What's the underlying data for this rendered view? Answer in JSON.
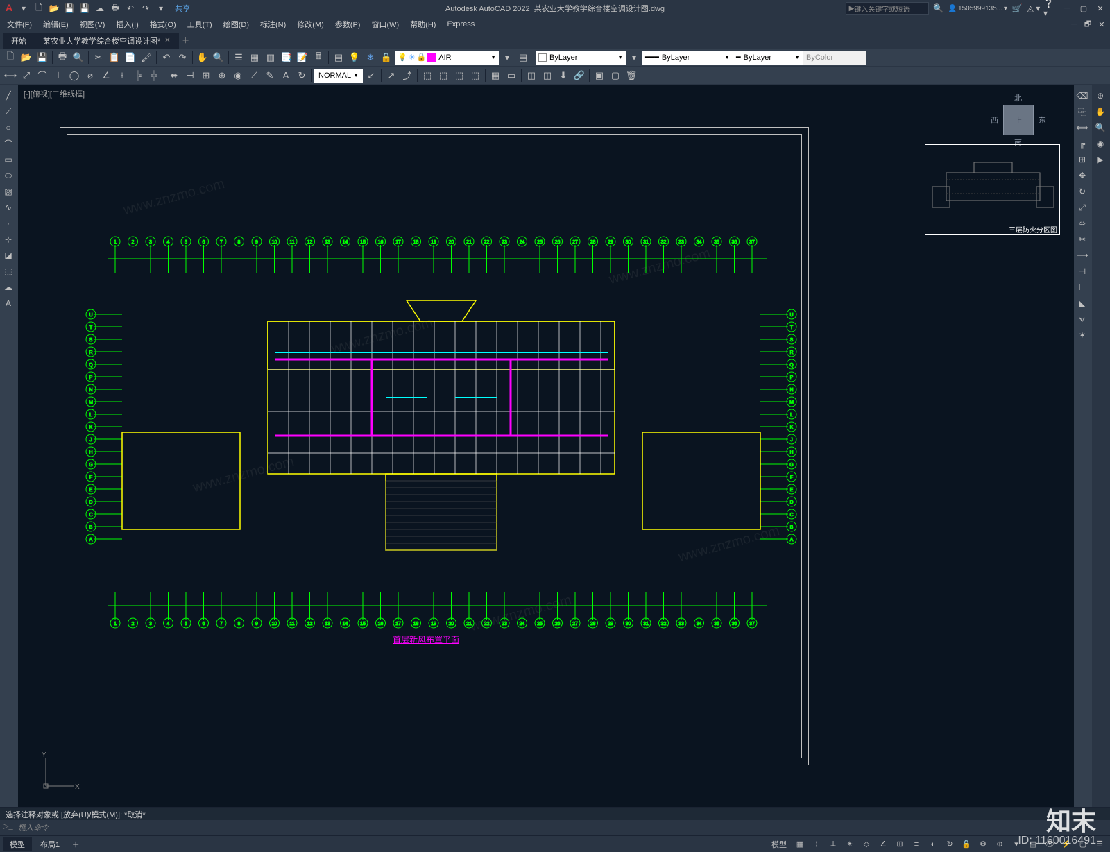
{
  "app": {
    "name": "Autodesk AutoCAD 2022",
    "filename": "某农业大学教学综合楼空调设计图.dwg",
    "share": "共享",
    "search_placeholder": "键入关键字或短语",
    "user": "1505999135..."
  },
  "menubar": [
    "文件(F)",
    "编辑(E)",
    "视图(V)",
    "插入(I)",
    "格式(O)",
    "工具(T)",
    "绘图(D)",
    "标注(N)",
    "修改(M)",
    "参数(P)",
    "窗口(W)",
    "帮助(H)",
    "Express"
  ],
  "tabs": {
    "start": "开始",
    "file": "某农业大学教学综合楼空调设计图*"
  },
  "layer": {
    "current": "AIR",
    "color": "#ff00ff",
    "bylayer1": "ByLayer",
    "bylayer2": "ByLayer",
    "bylayer3": "ByLayer",
    "bycolor": "ByColor"
  },
  "style": {
    "normal": "NORMAL"
  },
  "viewport": {
    "label": "[-][俯视][二维线框]"
  },
  "viewcube": {
    "top": "上",
    "n": "北",
    "s": "南",
    "e": "东",
    "w": "西"
  },
  "drawing": {
    "title": "首层新风布置平面",
    "inset_title": "三层防火分区图",
    "grid_numbers_top": [
      "1",
      "2",
      "3",
      "4",
      "5",
      "6",
      "7",
      "8",
      "9",
      "10",
      "11",
      "12",
      "13",
      "14",
      "15",
      "16",
      "17",
      "18",
      "19",
      "20",
      "21",
      "22",
      "23",
      "24",
      "25",
      "26",
      "27",
      "28",
      "29",
      "30",
      "31",
      "32",
      "33",
      "34",
      "35",
      "36",
      "37"
    ],
    "grid_letters_left": [
      "U",
      "T",
      "S",
      "R",
      "Q",
      "P",
      "N",
      "M",
      "L",
      "K",
      "J",
      "H",
      "G",
      "F",
      "E",
      "D",
      "C",
      "B",
      "A"
    ]
  },
  "command": {
    "history": "选择注释对象或 [放弃(U)/模式(M)]: *取消*",
    "prompt": "键入命令"
  },
  "status": {
    "model": "模型",
    "layout": "布局1"
  },
  "watermark": {
    "brand": "知末",
    "id": "ID: 1160016491",
    "url": "www.znzmo.com"
  }
}
